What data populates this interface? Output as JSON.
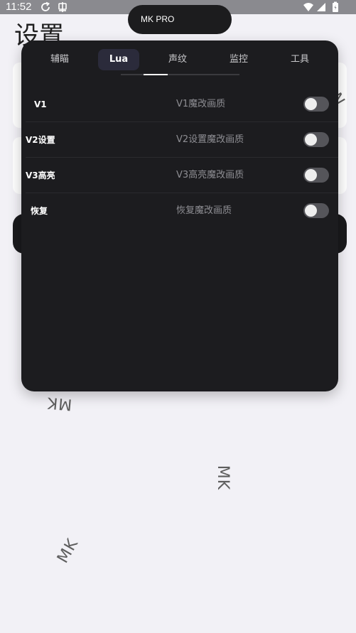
{
  "status_bar": {
    "time": "11:52"
  },
  "background": {
    "title": "设置"
  },
  "pill": {
    "title": "MK PRO"
  },
  "tabs": [
    {
      "label": "辅瞄"
    },
    {
      "label": "Lua"
    },
    {
      "label": "声纹"
    },
    {
      "label": "监控"
    },
    {
      "label": "工具"
    }
  ],
  "active_tab": "Lua",
  "rows": [
    {
      "label": "V1",
      "description": "V1魔改画质",
      "enabled": false
    },
    {
      "label": "V2设置",
      "description": "V2设置魔改画质",
      "enabled": false
    },
    {
      "label": "V3高亮",
      "description": "V3高亮魔改画质",
      "enabled": false
    },
    {
      "label": "恢复",
      "description": "恢复魔改画质",
      "enabled": false
    }
  ],
  "watermark": {
    "text": "MK"
  },
  "colors": {
    "panel_bg": "#1c1c1f",
    "active_tab_bg": "#2b2b3b",
    "switch_off": "#55555a",
    "page_bg": "#f2f1f6"
  },
  "icons": [
    "sync-icon",
    "bug-icon",
    "wifi-icon",
    "cellular-signal-icon",
    "battery-icon"
  ]
}
